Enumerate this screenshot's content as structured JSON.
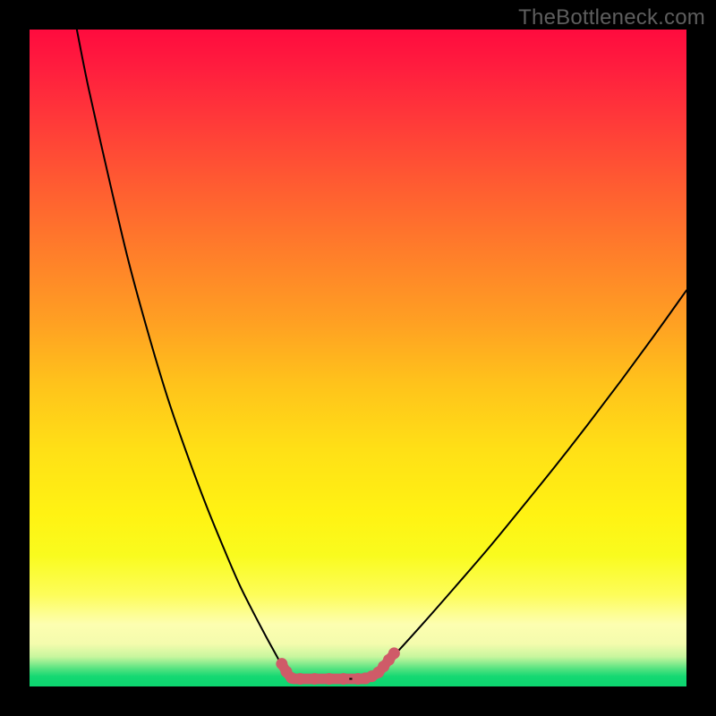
{
  "watermark": {
    "text": "TheBottleneck.com"
  },
  "gradient": {
    "stops": [
      {
        "offset": 0.0,
        "color": "#ff0b3e"
      },
      {
        "offset": 0.06,
        "color": "#ff1e3e"
      },
      {
        "offset": 0.14,
        "color": "#ff3a39"
      },
      {
        "offset": 0.24,
        "color": "#ff5d31"
      },
      {
        "offset": 0.34,
        "color": "#ff7e2a"
      },
      {
        "offset": 0.44,
        "color": "#ff9e23"
      },
      {
        "offset": 0.54,
        "color": "#ffc31b"
      },
      {
        "offset": 0.64,
        "color": "#ffe016"
      },
      {
        "offset": 0.74,
        "color": "#fff313"
      },
      {
        "offset": 0.8,
        "color": "#f9fb1e"
      },
      {
        "offset": 0.86,
        "color": "#fdfd59"
      },
      {
        "offset": 0.905,
        "color": "#fdfeb0"
      },
      {
        "offset": 0.935,
        "color": "#f4fcad"
      },
      {
        "offset": 0.955,
        "color": "#c7f69e"
      },
      {
        "offset": 0.974,
        "color": "#4ee27f"
      },
      {
        "offset": 0.985,
        "color": "#14d872"
      },
      {
        "offset": 1.0,
        "color": "#0cd56f"
      }
    ]
  },
  "chart_data": {
    "type": "line",
    "title": "",
    "xlabel": "",
    "ylabel": "",
    "xlim": [
      0,
      100
    ],
    "ylim": [
      0,
      100
    ],
    "grid": false,
    "series": [
      {
        "name": "left-curve",
        "x": [
          7.2,
          9,
          12,
          15,
          18,
          21,
          24,
          27,
          30,
          32,
          34,
          36,
          37.7,
          39.5
        ],
        "values": [
          100,
          91,
          77.7,
          65,
          54,
          44,
          35.3,
          27.3,
          20,
          15.4,
          11.4,
          7.6,
          4.5,
          1.15
        ]
      },
      {
        "name": "right-curve",
        "x": [
          52,
          55,
          60,
          65,
          70,
          75,
          80,
          85,
          90,
          95,
          100
        ],
        "values": [
          1.15,
          4.2,
          9.7,
          15.4,
          21.2,
          27.3,
          33.5,
          39.9,
          46.5,
          53.3,
          60.3
        ]
      },
      {
        "name": "flat-bottom",
        "x": [
          39.5,
          52
        ],
        "values": [
          1.15,
          1.15
        ]
      },
      {
        "name": "left-marker-trail",
        "marker": true,
        "color": "#cf5b68",
        "x": [
          38.4,
          39.1,
          39.9,
          41.2,
          43.4,
          45.6,
          47.8
        ],
        "values": [
          3.45,
          2.25,
          1.3,
          1.15,
          1.15,
          1.15,
          1.15
        ]
      },
      {
        "name": "right-marker-trail",
        "marker": true,
        "color": "#cf5b68",
        "x": [
          50.0,
          51.1,
          52.1,
          53.1,
          53.9,
          54.7,
          55.5
        ],
        "values": [
          1.15,
          1.25,
          1.55,
          2.15,
          3.05,
          4.05,
          5.05
        ]
      }
    ],
    "flat_bar": {
      "color": "#cf5b68",
      "y": 1.15,
      "x0": 39.5,
      "x1": 52,
      "thickness_pct": 1.6
    }
  }
}
